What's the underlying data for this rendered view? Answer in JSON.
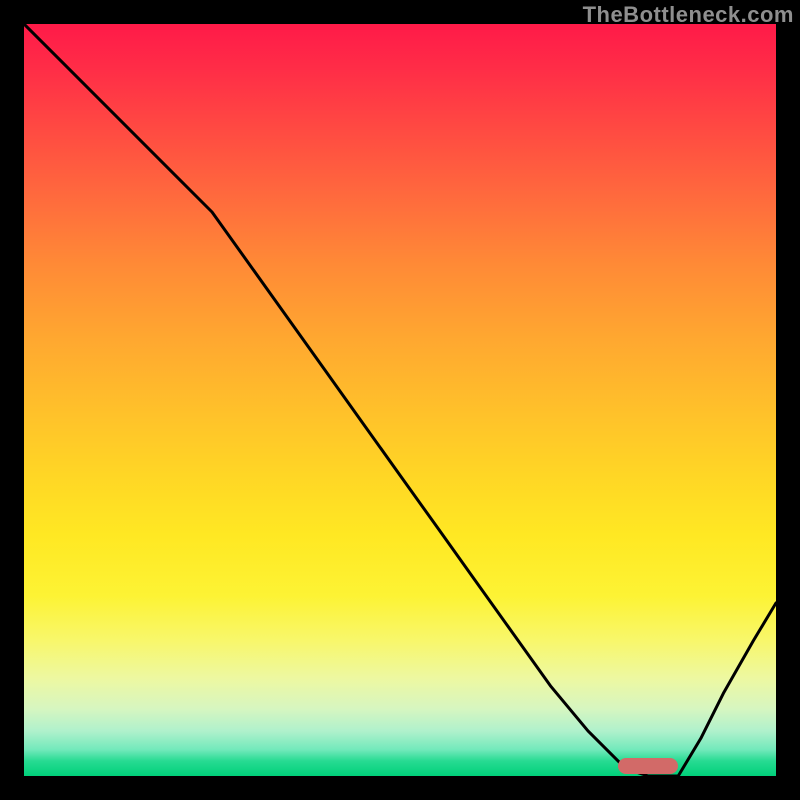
{
  "watermark": "TheBottleneck.com",
  "colors": {
    "background": "#000000",
    "curve": "#000000",
    "marker": "#d26a68",
    "gradient_top": "#ff1a48",
    "gradient_bottom": "#00d07a"
  },
  "chart_data": {
    "type": "line",
    "title": "",
    "xlabel": "",
    "ylabel": "",
    "xlim": [
      0,
      100
    ],
    "ylim": [
      0,
      100
    ],
    "grid": false,
    "legend": false,
    "annotations": [
      {
        "kind": "optimum_marker",
        "x_range": [
          79,
          87
        ],
        "y": 0
      }
    ],
    "series": [
      {
        "name": "bottleneck-curve",
        "x": [
          0,
          5,
          10,
          15,
          20,
          25,
          30,
          35,
          40,
          45,
          50,
          55,
          60,
          65,
          70,
          75,
          80,
          83,
          87,
          90,
          93,
          97,
          100
        ],
        "y": [
          100,
          95,
          90,
          85,
          80,
          75,
          68,
          61,
          54,
          47,
          40,
          33,
          26,
          19,
          12,
          6,
          1,
          0,
          0,
          5,
          11,
          18,
          23
        ]
      }
    ]
  }
}
